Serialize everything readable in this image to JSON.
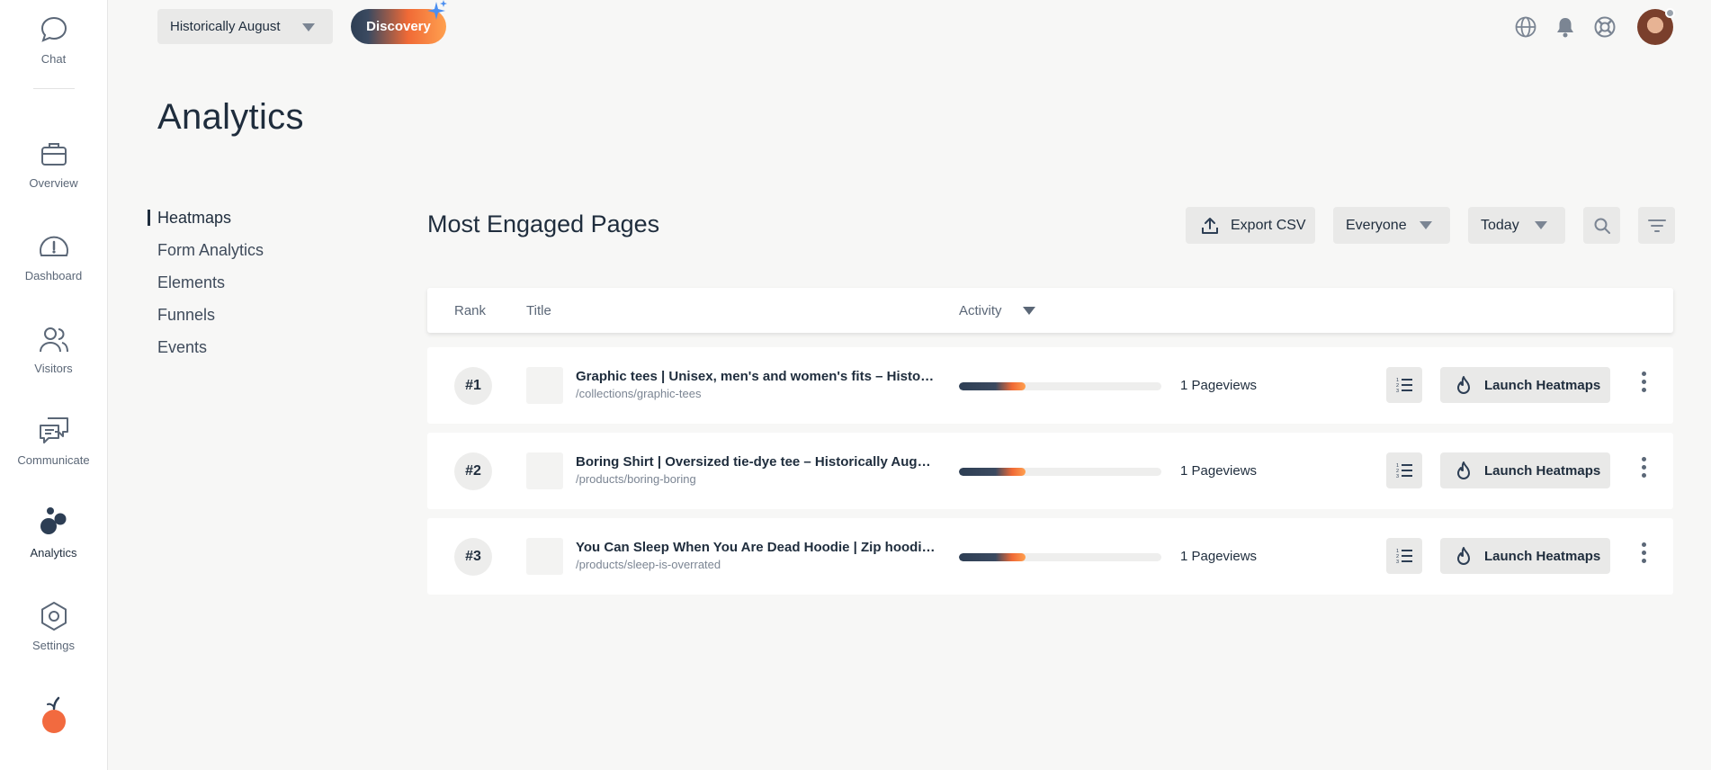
{
  "sidebar": {
    "items": [
      {
        "label": "Chat",
        "icon": "chat-bubble-icon"
      },
      {
        "label": "Overview",
        "icon": "briefcase-icon"
      },
      {
        "label": "Dashboard",
        "icon": "gauge-icon"
      },
      {
        "label": "Visitors",
        "icon": "users-icon"
      },
      {
        "label": "Communicate",
        "icon": "messages-icon"
      },
      {
        "label": "Analytics",
        "icon": "analytics-bubbles-icon",
        "active": true
      },
      {
        "label": "Settings",
        "icon": "hexagon-gear-icon"
      }
    ],
    "logo": "orange-logo"
  },
  "topbar": {
    "site_name": "Historically August",
    "discovery_label": "Discovery",
    "icons": [
      "globe-icon",
      "bell-icon",
      "help-lifebuoy-icon"
    ],
    "avatar": "user-avatar"
  },
  "page": {
    "title": "Analytics"
  },
  "subnav": {
    "items": [
      "Heatmaps",
      "Form Analytics",
      "Elements",
      "Funnels",
      "Events"
    ],
    "active": "Heatmaps"
  },
  "section": {
    "title": "Most Engaged Pages",
    "export_label": "Export CSV",
    "segment_label": "Everyone",
    "date_label": "Today"
  },
  "table": {
    "columns": {
      "rank": "Rank",
      "title": "Title",
      "activity": "Activity"
    },
    "rows": [
      {
        "rank": "#1",
        "title": "Graphic tees | Unisex, men's and women's fits – Historically August",
        "path": "/collections/graphic-tees",
        "views": "1 Pageviews",
        "activity_fraction": 0.33,
        "action": "Launch Heatmaps"
      },
      {
        "rank": "#2",
        "title": "Boring Shirt | Oversized tie-dye tee – Historically August",
        "path": "/products/boring-boring",
        "views": "1 Pageviews",
        "activity_fraction": 0.33,
        "action": "Launch Heatmaps"
      },
      {
        "rank": "#3",
        "title": "You Can Sleep When You Are Dead Hoodie | Zip hoodie – Historically August",
        "path": "/products/sleep-is-overrated",
        "views": "1 Pageviews",
        "activity_fraction": 0.33,
        "action": "Launch Heatmaps"
      }
    ]
  },
  "colors": {
    "accent_dark": "#2d3e54",
    "accent_orange": "#f06a36",
    "accent_light_orange": "#ffa04f",
    "background": "#f7f7f6"
  }
}
